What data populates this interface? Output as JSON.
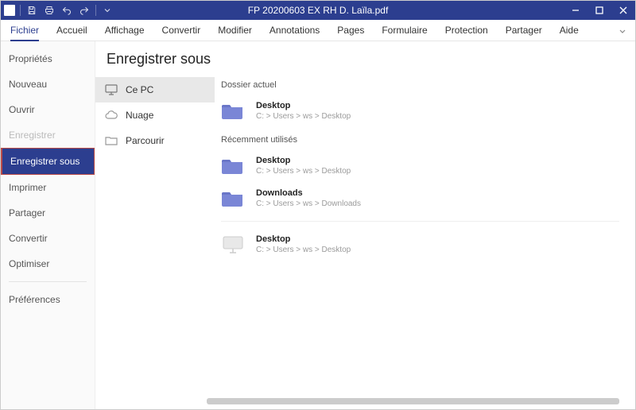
{
  "window": {
    "title": "FP 20200603 EX RH D. Laïla.pdf"
  },
  "menubar": {
    "items": [
      "Fichier",
      "Accueil",
      "Affichage",
      "Convertir",
      "Modifier",
      "Annotations",
      "Pages",
      "Formulaire",
      "Protection",
      "Partager",
      "Aide"
    ],
    "active_index": 0
  },
  "sidebar": {
    "items": [
      {
        "label": "Propriétés",
        "state": "normal"
      },
      {
        "label": "Nouveau",
        "state": "normal"
      },
      {
        "label": "Ouvrir",
        "state": "normal"
      },
      {
        "label": "Enregistrer",
        "state": "disabled"
      },
      {
        "label": "Enregistrer sous",
        "state": "selected"
      },
      {
        "label": "Imprimer",
        "state": "normal"
      },
      {
        "label": "Partager",
        "state": "normal"
      },
      {
        "label": "Convertir",
        "state": "normal"
      },
      {
        "label": "Optimiser",
        "state": "normal"
      }
    ],
    "footer": {
      "label": "Préférences"
    }
  },
  "main": {
    "title": "Enregistrer sous",
    "locations": [
      {
        "icon": "monitor",
        "label": "Ce PC",
        "selected": true
      },
      {
        "icon": "cloud",
        "label": "Nuage",
        "selected": false
      },
      {
        "icon": "folder-outline",
        "label": "Parcourir",
        "selected": false
      }
    ],
    "current_label": "Dossier actuel",
    "current": {
      "title": "Desktop",
      "path": "C: > Users > ws > Desktop"
    },
    "recent_label": "Récemment utilisés",
    "recent": [
      {
        "title": "Desktop",
        "path": "C: > Users > ws > Desktop"
      },
      {
        "title": "Downloads",
        "path": "C: > Users > ws > Downloads"
      }
    ],
    "other": [
      {
        "title": "Desktop",
        "path": "C: > Users > ws > Desktop",
        "icon": "monitor"
      }
    ]
  }
}
